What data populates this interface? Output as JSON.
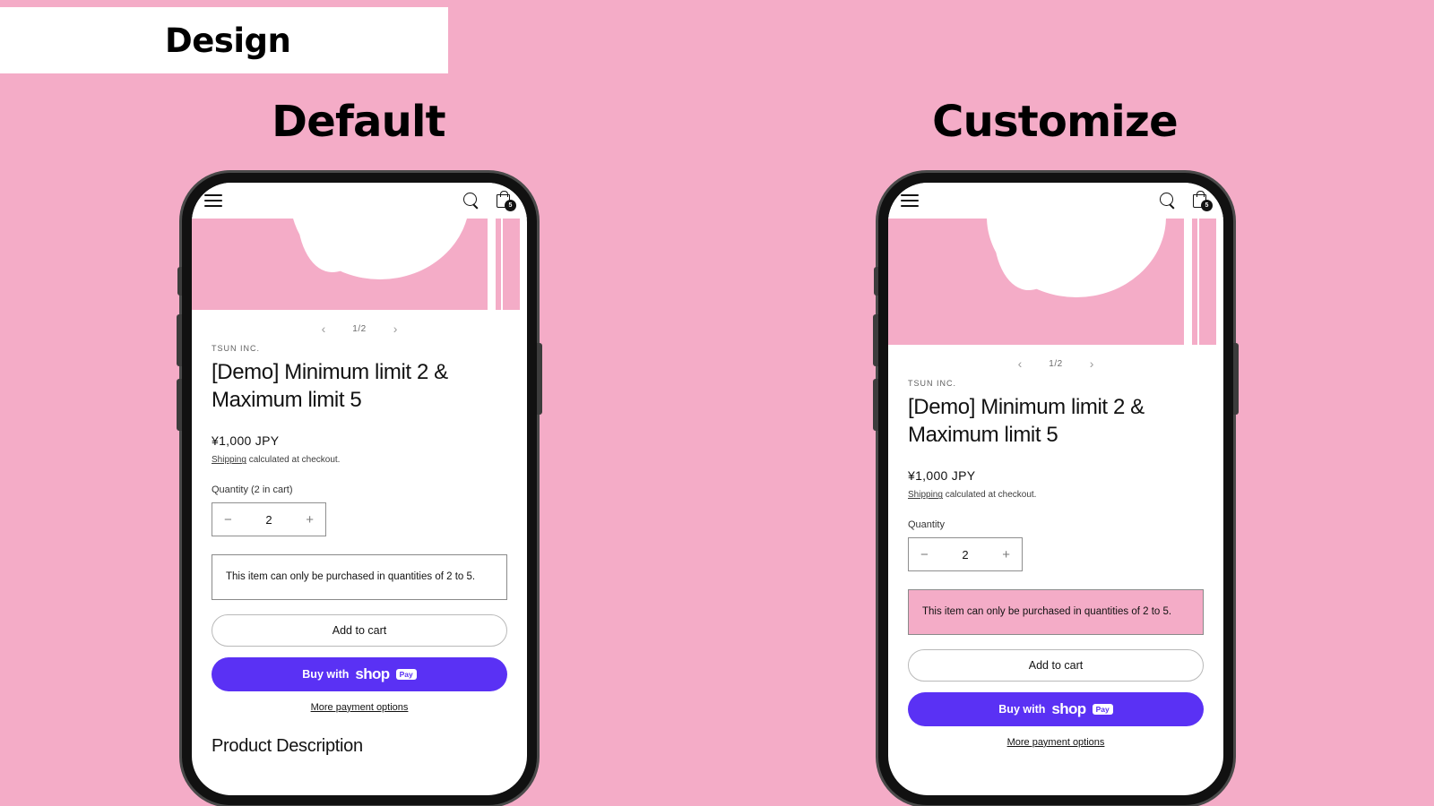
{
  "banner": {
    "title": "Design"
  },
  "columns": [
    {
      "key": "default",
      "title": "Default"
    },
    {
      "key": "customize",
      "title": "Customize"
    }
  ],
  "colors": {
    "background_pink": "#F4ACC7",
    "shop_pay_purple": "#5A31F4",
    "notice_highlight": "#F4ACC7",
    "text": "#121212"
  },
  "phone_header": {
    "menu_icon": "hamburger-menu-icon",
    "search_icon": "search-icon",
    "cart_icon": "shopping-cart-icon",
    "cart_count": "5"
  },
  "gallery": {
    "counter": "1/2",
    "prev_arrow": "‹",
    "next_arrow": "›"
  },
  "product": {
    "vendor": "TSUN INC.",
    "title": "[Demo] Minimum limit 2 & Maximum limit 5",
    "price": "¥1,000 JPY",
    "shipping_link": "Shipping",
    "shipping_text": "calculated at checkout.",
    "notice": "This item can only be purchased in quantities of 2 to 5.",
    "quantity_value": "2",
    "minus_symbol": "−",
    "plus_symbol": "+",
    "add_to_cart": "Add to cart",
    "shop_pay_prefix": "Buy with",
    "shop_pay_word": "shop",
    "shop_pay_tag": "Pay",
    "more_payment_options": "More payment options",
    "section_heading": "Product Description"
  },
  "variants": {
    "default": {
      "quantity_label": "Quantity (2 in cart)"
    },
    "customize": {
      "quantity_label": "Quantity"
    }
  }
}
